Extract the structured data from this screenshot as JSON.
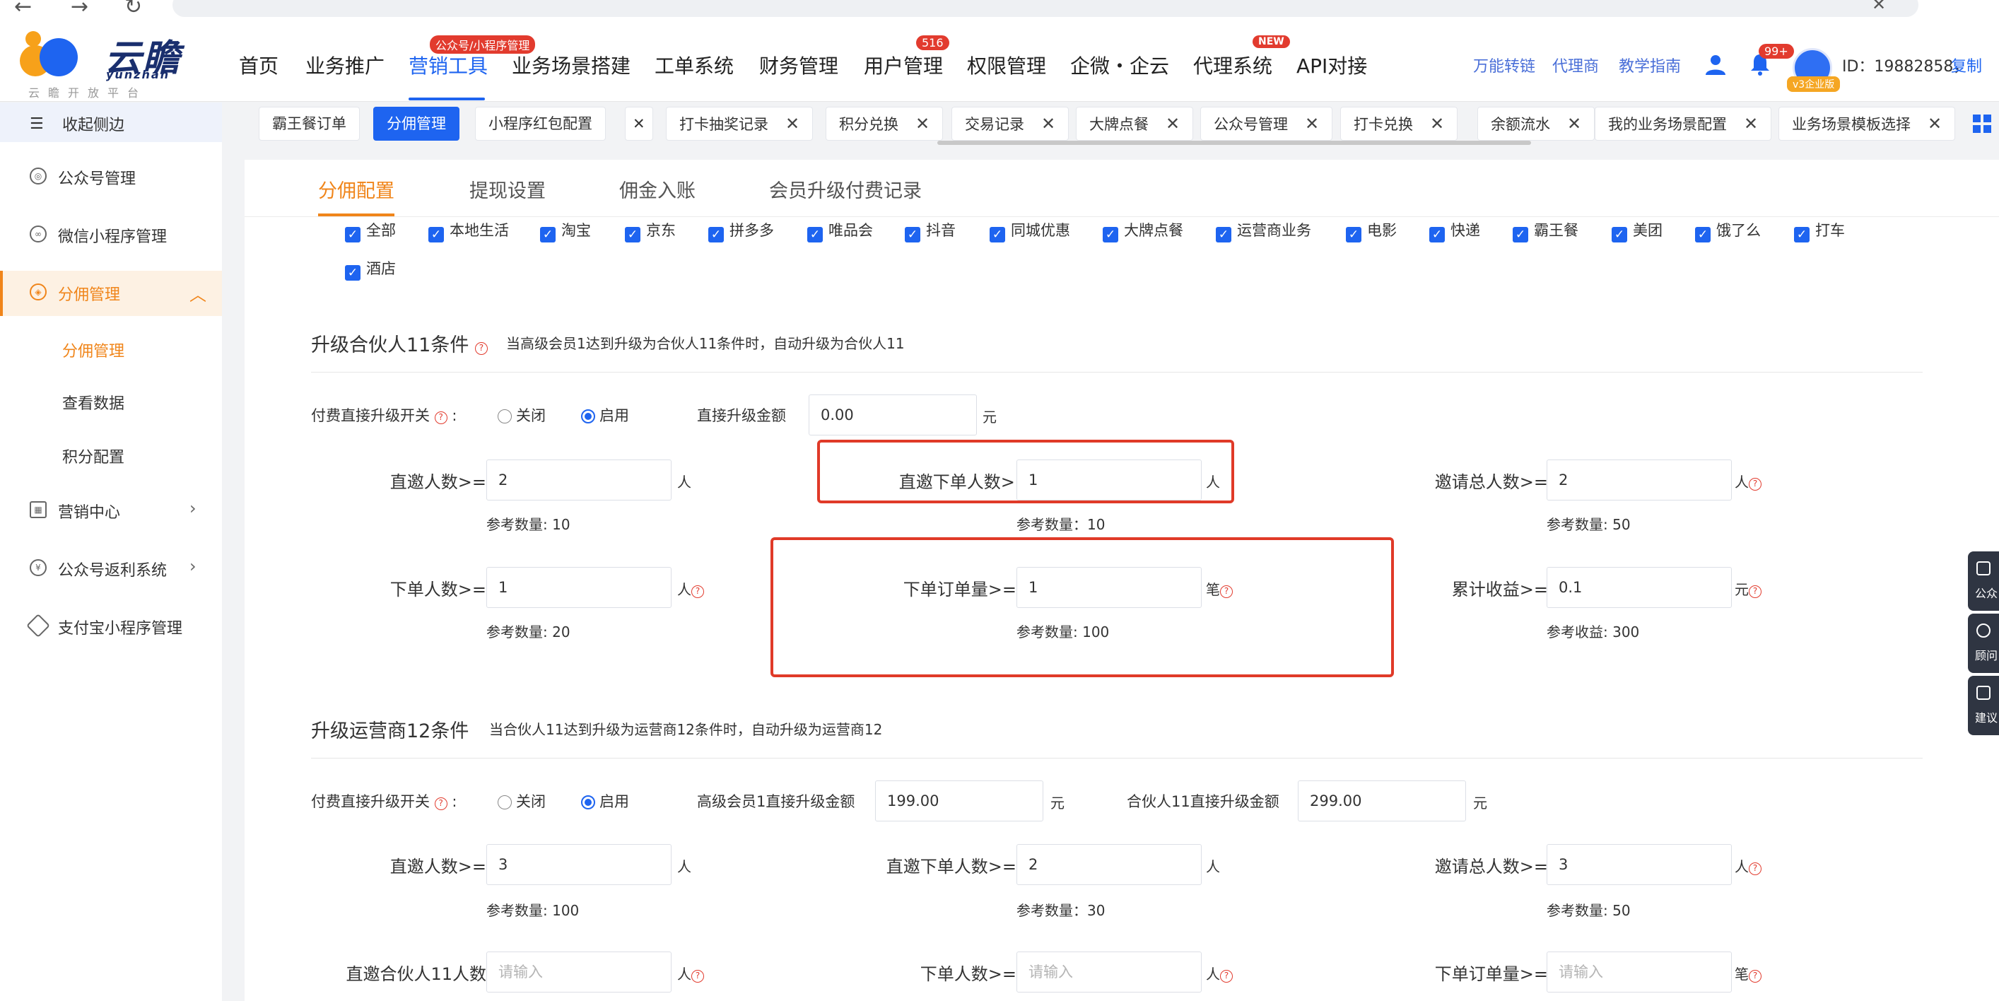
{
  "browser": {
    "back": "←",
    "forward": "→",
    "reload": "↻",
    "close": "✕"
  },
  "header": {
    "logo_text": "云瞻",
    "logo_en": "yunzhan",
    "logo_sub": "云瞻开放平台",
    "nav": [
      "首页",
      "业务推广",
      "营销工具",
      "业务场景搭建",
      "工单系统",
      "财务管理",
      "用户管理",
      "权限管理",
      "企微・企云",
      "代理系统",
      "API对接"
    ],
    "nav_badges": {
      "marketing": "公众号/小程序管理",
      "users": "516",
      "agent": "NEW"
    },
    "links": [
      "万能转链",
      "代理商",
      "教学指南"
    ],
    "bell_badge": "99+",
    "version_tag": "v3企业版",
    "user_id": "ID：19882858，",
    "copy": "复制"
  },
  "sidebar": {
    "collapse": "收起侧边",
    "items": [
      {
        "label": "公众号管理",
        "icon": "wechat-official-icon"
      },
      {
        "label": "微信小程序管理",
        "icon": "miniprogram-icon"
      },
      {
        "label": "分佣管理",
        "icon": "commission-icon"
      },
      {
        "label": "营销中心",
        "icon": "gift-icon"
      },
      {
        "label": "公众号返利系统",
        "icon": "rebate-icon"
      },
      {
        "label": "支付宝小程序管理",
        "icon": "alipay-icon"
      }
    ],
    "subitems": [
      "分佣管理",
      "查看数据",
      "积分配置"
    ]
  },
  "tabs": [
    "霸王餐订单",
    "分佣管理",
    "小程序红包配置",
    "打卡抽奖记录",
    "积分兑换",
    "交易记录",
    "大牌点餐",
    "公众号管理",
    "打卡兑换",
    "余额流水",
    "我的业务场景配置",
    "业务场景模板选择"
  ],
  "subtabs": [
    "分佣配置",
    "提现设置",
    "佣金入账",
    "会员升级付费记录"
  ],
  "categories": [
    "全部",
    "本地生活",
    "淘宝",
    "京东",
    "拼多多",
    "唯品会",
    "抖音",
    "同城优惠",
    "大牌点餐",
    "运营商业务",
    "电影",
    "快递",
    "霸王餐",
    "美团",
    "饿了么",
    "打车",
    "酒店"
  ],
  "section1": {
    "title": "升级合伙人11条件",
    "desc": "当高级会员1达到升级为合伙人11条件时，自动升级为合伙人11",
    "paid_switch": "付费直接升级开关",
    "off": "关闭",
    "on": "启用",
    "direct_amount_label": "直接升级金额",
    "direct_amount": "0.00",
    "yuan": "元",
    "fields": [
      {
        "label": "直邀人数>=",
        "value": "2",
        "unit": "人",
        "ref": "参考数量: 10"
      },
      {
        "label": "直邀下单人数>=",
        "value": "1",
        "unit": "人",
        "ref": "参考数量：10"
      },
      {
        "label": "邀请总人数>=",
        "value": "2",
        "unit": "人",
        "ref": "参考数量: 50"
      },
      {
        "label": "下单人数>=",
        "value": "1",
        "unit": "人",
        "ref": "参考数量: 20"
      },
      {
        "label": "下单订单量>=",
        "value": "1",
        "unit": "笔",
        "ref": "参考数量: 100"
      },
      {
        "label": "累计收益>=",
        "value": "0.1",
        "unit": "元",
        "ref": "参考收益: 300"
      }
    ]
  },
  "section2": {
    "title": "升级运营商12条件",
    "desc": "当合伙人11达到升级为运营商12条件时，自动升级为运营商12",
    "paid_switch": "付费直接升级开关",
    "off": "关闭",
    "on": "启用",
    "amount1_label": "高级会员1直接升级金额",
    "amount1": "199.00",
    "amount2_label": "合伙人11直接升级金额",
    "amount2": "299.00",
    "yuan": "元",
    "fields": [
      {
        "label": "直邀人数>=",
        "value": "3",
        "unit": "人",
        "ref": "参考数量: 100"
      },
      {
        "label": "直邀下单人数>=",
        "value": "2",
        "unit": "人",
        "ref": "参考数量：30"
      },
      {
        "label": "邀请总人数>=",
        "value": "3",
        "unit": "人",
        "ref": "参考数量: 50"
      },
      {
        "label": "直邀合伙人11人数",
        "value": "",
        "unit": "人",
        "placeholder": "请输入"
      },
      {
        "label": "下单人数>=",
        "value": "",
        "unit": "人",
        "placeholder": "请输入"
      },
      {
        "label": "下单订单量>=",
        "value": "",
        "unit": "笔",
        "placeholder": "请输入"
      }
    ]
  },
  "float_buttons": [
    "公众",
    "顾问",
    "建议"
  ],
  "accent": "#1e64f0",
  "highlight": "#f0851a",
  "annotation_color": "#e03a28"
}
